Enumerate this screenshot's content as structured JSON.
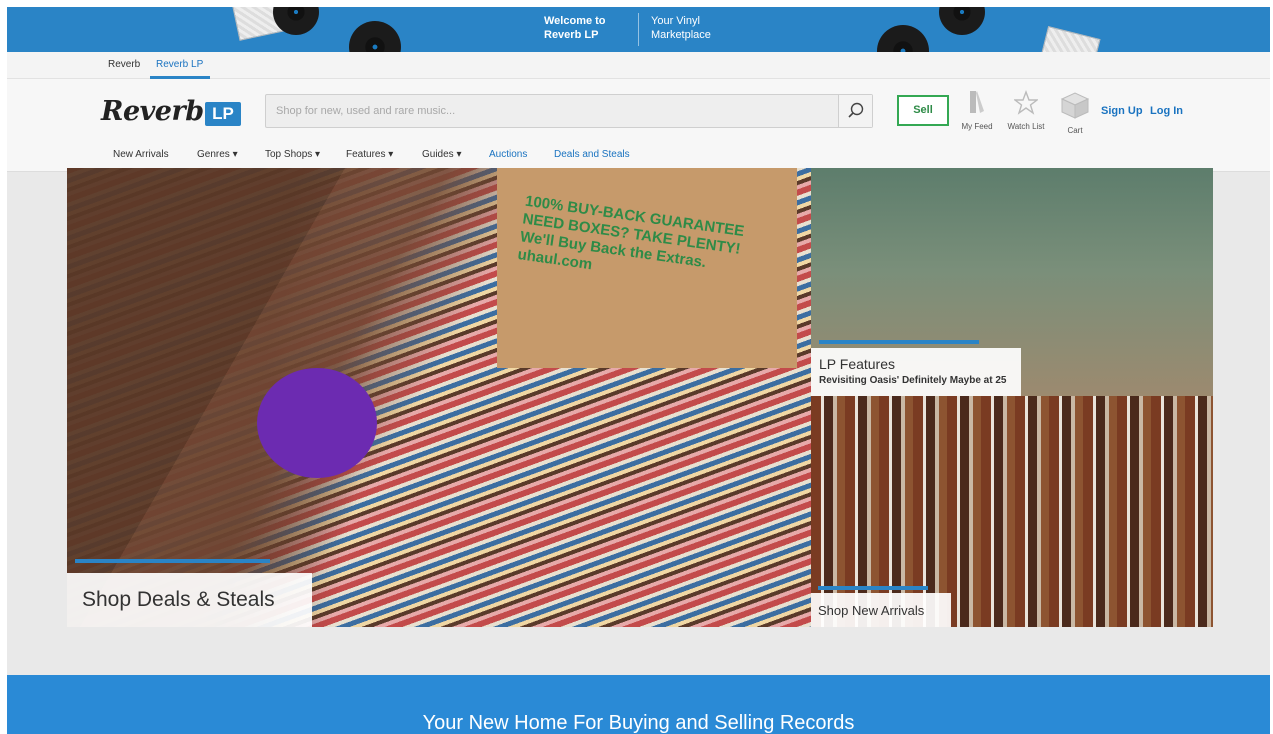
{
  "banner": {
    "line_left": "Welcome to Reverb LP",
    "line_right": "Your Vinyl Marketplace"
  },
  "site_tabs": [
    {
      "label": "Reverb"
    },
    {
      "label": "Reverb LP"
    }
  ],
  "logo": {
    "text": "Reverb",
    "badge": "LP"
  },
  "search": {
    "placeholder": "Shop for new, used and rare music...",
    "icon": "search-icon"
  },
  "header_actions": {
    "sell": "Sell",
    "my_feed": "My Feed",
    "watch_list": "Watch List",
    "cart": "Cart",
    "sign_up": "Sign Up",
    "log_in": "Log In"
  },
  "category_nav": [
    {
      "label": "New Arrivals"
    },
    {
      "label": "Genres ▾"
    },
    {
      "label": "Top Shops ▾"
    },
    {
      "label": "Features ▾"
    },
    {
      "label": "Guides ▾"
    },
    {
      "label": "Auctions"
    },
    {
      "label": "Deals and Steals"
    }
  ],
  "hero": {
    "main_caption": "Shop Deals & Steals",
    "box_text": "100% BUY-BACK GUARANTEE NEED BOXES? TAKE PLENTY! We'll Buy Back the Extras. uhaul.com",
    "feature_title": "LP Features",
    "feature_sub": "Revisiting Oasis' Definitely Maybe at 25",
    "new_arrivals": "Shop New Arrivals"
  },
  "bottom_band": {
    "text": "Your New Home For Buying and Selling Records"
  },
  "colors": {
    "brand_blue": "#2a84c6",
    "sell_green": "#34a853"
  }
}
